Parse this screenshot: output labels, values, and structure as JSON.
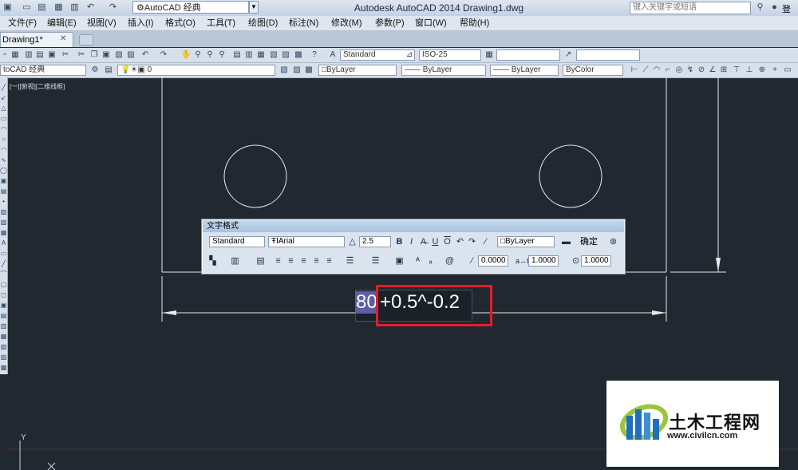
{
  "title_bar": {
    "workspace": "AutoCAD 经典",
    "app_title": "Autodesk AutoCAD 2014    Drawing1.dwg",
    "search_placeholder": "键入关键字或短语",
    "login_label": "登录"
  },
  "menu": [
    "文件(F)",
    "编辑(E)",
    "视图(V)",
    "插入(I)",
    "格式(O)",
    "工具(T)",
    "绘图(D)",
    "标注(N)",
    "修改(M)",
    "参数(P)",
    "窗口(W)",
    "帮助(H)"
  ],
  "tabs": {
    "document": "Drawing1*",
    "close": "✕"
  },
  "toolbar1": {
    "text_style": "Standard",
    "dim_style": "ISO-25"
  },
  "toolbar2": {
    "workspace": "toCAD 经典",
    "layer": "0",
    "color": "ByLayer",
    "linetype": "ByLayer",
    "lineweight": "ByLayer",
    "plot_style": "ByColor"
  },
  "viewport_label": "[一][俯视][二维线框]",
  "text_formatting": {
    "title": "文字格式",
    "style": "Standard",
    "font": "Arial",
    "height": "2.5",
    "color": "ByLayer",
    "ok_label": "确定",
    "oblique": "0.0000",
    "tracking": "1.0000",
    "width_factor": "1.0000"
  },
  "editor_text": {
    "selected": "80",
    "rest": "+0.5^-0.2"
  },
  "ucs": {
    "y_label": "Y"
  },
  "watermark": {
    "title": "土木工程网",
    "url": "www.civilcn.com"
  },
  "colors": {
    "canvas": "#212830",
    "highlight": "#e41e27",
    "selection": "#5b5ea8"
  }
}
